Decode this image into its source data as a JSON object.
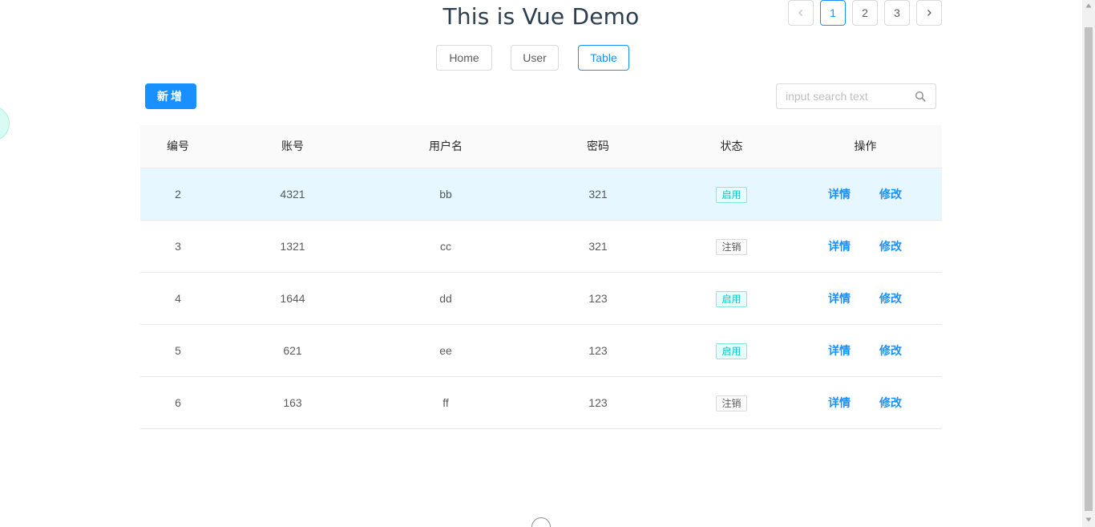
{
  "page": {
    "title": "This is Vue Demo"
  },
  "nav": {
    "items": [
      {
        "label": "Home"
      },
      {
        "label": "User"
      },
      {
        "label": "Table"
      }
    ],
    "active": "Table"
  },
  "toolbar": {
    "add_label": "新增",
    "search_placeholder": "input search text",
    "search_value": ""
  },
  "table": {
    "columns": [
      "编号",
      "账号",
      "用户名",
      "密码",
      "状态",
      "操作"
    ],
    "rows": [
      {
        "id": "2",
        "account": "4321",
        "username": "bb",
        "password": "321",
        "status": "启用",
        "status_type": "enabled",
        "detail": "详情",
        "edit": "修改"
      },
      {
        "id": "3",
        "account": "1321",
        "username": "cc",
        "password": "321",
        "status": "注销",
        "status_type": "disabled",
        "detail": "详情",
        "edit": "修改"
      },
      {
        "id": "4",
        "account": "1644",
        "username": "dd",
        "password": "123",
        "status": "启用",
        "status_type": "enabled",
        "detail": "详情",
        "edit": "修改"
      },
      {
        "id": "5",
        "account": "621",
        "username": "ee",
        "password": "123",
        "status": "启用",
        "status_type": "enabled",
        "detail": "详情",
        "edit": "修改"
      },
      {
        "id": "6",
        "account": "163",
        "username": "ff",
        "password": "123",
        "status": "注销",
        "status_type": "disabled",
        "detail": "详情",
        "edit": "修改"
      }
    ]
  },
  "pagination": {
    "pages": [
      "1",
      "2",
      "3"
    ],
    "current": "1",
    "prev_icon": "chevron-left-icon",
    "next_icon": "chevron-right-icon"
  },
  "colors": {
    "primary": "#1890ff",
    "enabled_tag": "#13c2c2",
    "row_highlight": "#e6f7ff"
  }
}
